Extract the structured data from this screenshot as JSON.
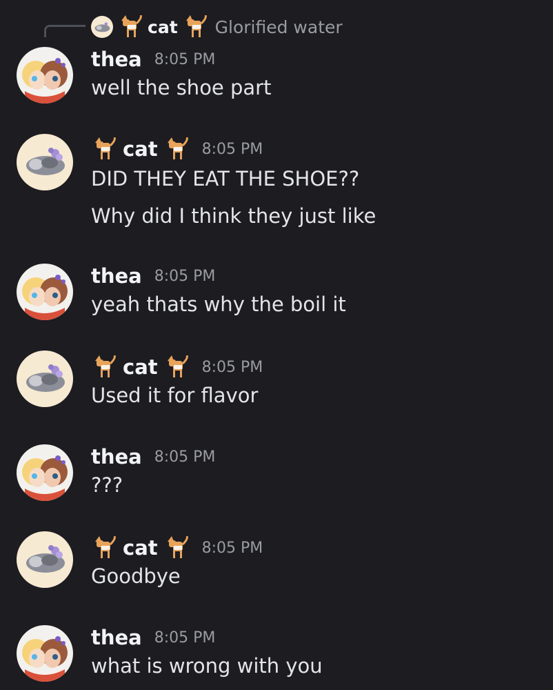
{
  "reply": {
    "author": "cat",
    "text": "Glorified water"
  },
  "colors": {
    "background": "#1c1c21",
    "name": "#f2f3f5",
    "timestamp": "#9a9ca3",
    "message_text": "#e4e5e8"
  },
  "messages": [
    {
      "author": "thea",
      "time": "8:05 PM",
      "lines": [
        "well the shoe part"
      ]
    },
    {
      "author": "cat",
      "time": "8:05 PM",
      "lines": [
        "DID THEY EAT THE SHOE??",
        "Why did I think they just like"
      ]
    },
    {
      "author": "thea",
      "time": "8:05 PM",
      "lines": [
        "yeah thats why the boil it"
      ]
    },
    {
      "author": "cat",
      "time": "8:05 PM",
      "lines": [
        "Used it for flavor"
      ]
    },
    {
      "author": "thea",
      "time": "8:05 PM",
      "lines": [
        "???"
      ]
    },
    {
      "author": "cat",
      "time": "8:05 PM",
      "lines": [
        "Goodbye"
      ]
    },
    {
      "author": "thea",
      "time": "8:05 PM",
      "lines": [
        "what is wrong with you"
      ]
    }
  ]
}
